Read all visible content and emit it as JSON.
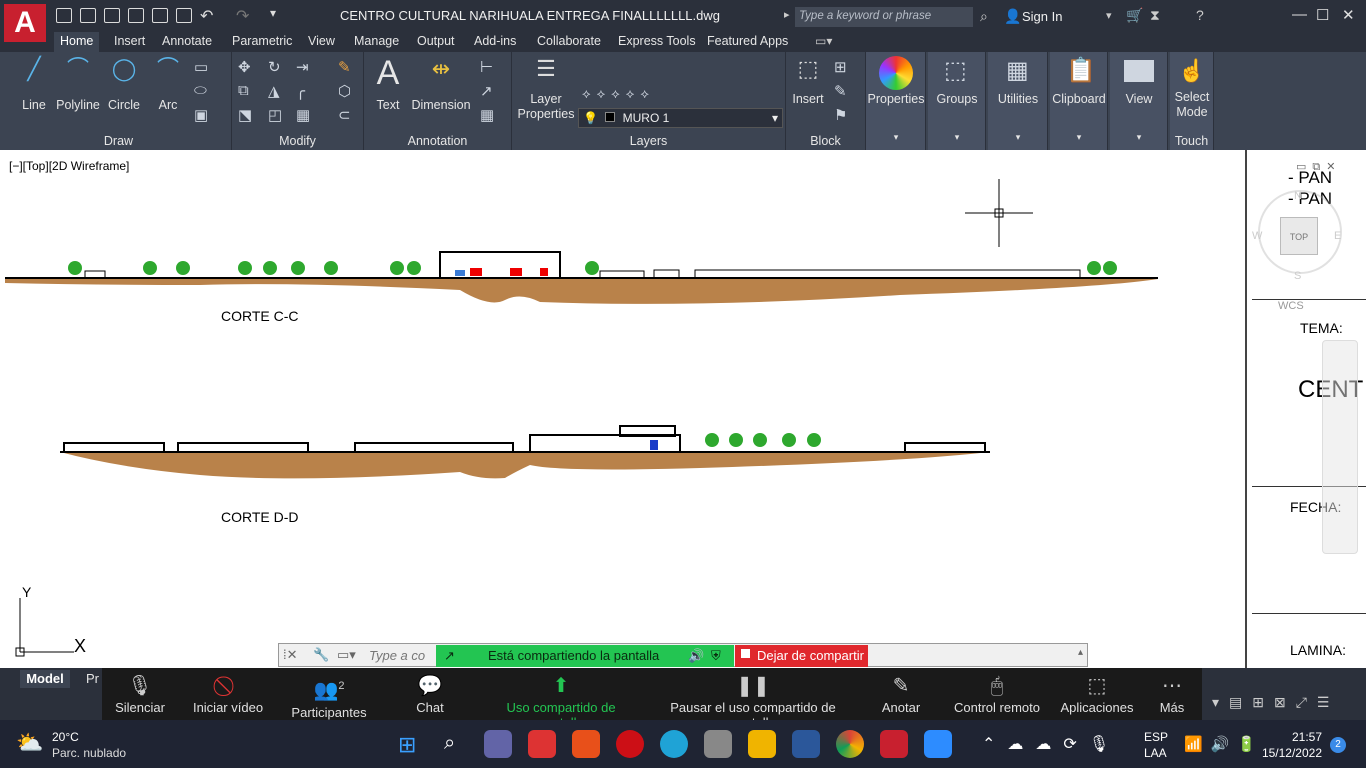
{
  "app": {
    "logo_letter": "A",
    "document_title": "CENTRO CULTURAL NARIHUALA ENTREGA FINALLLLLLL.dwg",
    "search_placeholder": "Type a keyword or phrase",
    "sign_in": "Sign In"
  },
  "tabs": [
    "Home",
    "Insert",
    "Annotate",
    "Parametric",
    "View",
    "Manage",
    "Output",
    "Add-ins",
    "Collaborate",
    "Express Tools",
    "Featured Apps"
  ],
  "ribbon": {
    "draw": {
      "title": "Draw",
      "tools": [
        "Line",
        "Polyline",
        "Circle",
        "Arc"
      ]
    },
    "modify": {
      "title": "Modify"
    },
    "annotation": {
      "title": "Annotation",
      "tools": [
        "Text",
        "Dimension"
      ]
    },
    "layers": {
      "title": "Layers",
      "tool": "Layer Properties",
      "current_layer": "MURO 1"
    },
    "block": {
      "title": "Block",
      "tool": "Insert"
    },
    "properties": "Properties",
    "groups": "Groups",
    "utilities": "Utilities",
    "clipboard": "Clipboard",
    "view": "View",
    "touch": {
      "tool": "Select Mode",
      "title": "Touch"
    }
  },
  "viewport": {
    "label": "[−][Top][2D Wireframe]",
    "section_labels": [
      "CORTE C-C",
      "CORTE D-D"
    ],
    "viewcube": {
      "top": "TOP",
      "n": "N",
      "s": "S",
      "e": "E",
      "w": "W",
      "wcs": "WCS"
    },
    "ucs": {
      "x": "X",
      "y": "Y"
    }
  },
  "title_block": {
    "pan1": "PAN",
    "pan2": "PAN",
    "tema": "TEMA:",
    "cent": "CENT",
    "fecha": "FECHA:",
    "lamina": "LAMINA:"
  },
  "layout_tabs": [
    "Model",
    "Pr"
  ],
  "command_line": {
    "placeholder": "Type a co"
  },
  "zoom": {
    "share_status": "Está compartiendo la pantalla",
    "stop_share": "Dejar de compartir",
    "buttons": [
      "Silenciar",
      "Iniciar vídeo",
      "Participantes",
      "Chat",
      "Uso compartido de pantalla",
      "Pausar el uso compartido de pantalla",
      "Anotar",
      "Control remoto",
      "Aplicaciones",
      "Más"
    ],
    "participants_count": "2",
    "colors": {
      "share": "#23c552",
      "stop": "#e0282d"
    }
  },
  "taskbar": {
    "temp": "20°C",
    "weather": "Parc. nublado",
    "lang1": "ESP",
    "lang2": "LAA",
    "time": "21:57",
    "date": "15/12/2022",
    "notif": "2"
  }
}
